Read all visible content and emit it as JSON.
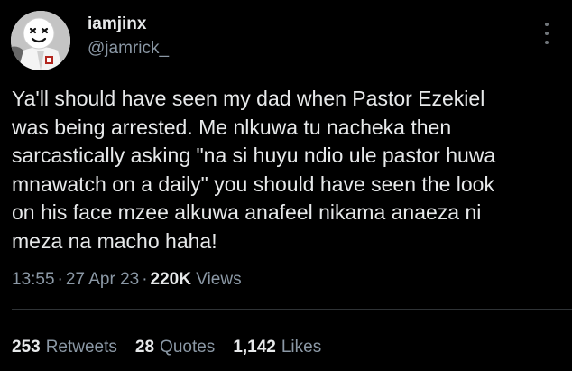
{
  "user": {
    "display_name": "iamjinx",
    "handle": "@jamrick_"
  },
  "tweet": {
    "lines": [
      "Ya'll should have seen my dad when Pastor Ezekiel",
      "was being arrested.  Me nlkuwa tu nacheka then",
      "sarcastically asking \"na si huyu ndio ule pastor huwa",
      "mnawatch on a daily\" you should have seen the look",
      "on his face mzee alkuwa anafeel nikama anaeza ni",
      "meza na  macho haha!"
    ],
    "time": "13:55",
    "date": "27 Apr 23",
    "separator": "·",
    "views_count": "220K",
    "views_label": "Views"
  },
  "stats": {
    "retweets_count": "253",
    "retweets_label": "Retweets",
    "quotes_count": "28",
    "quotes_label": "Quotes",
    "likes_count": "1,142",
    "likes_label": "Likes"
  },
  "icons": {
    "avatar": "marshmello-avatar",
    "more": "more-options-icon"
  },
  "colors": {
    "background": "#000000",
    "primary_text": "#e7e9ea",
    "secondary_text": "#8b98a5",
    "divider": "#2f3336"
  }
}
